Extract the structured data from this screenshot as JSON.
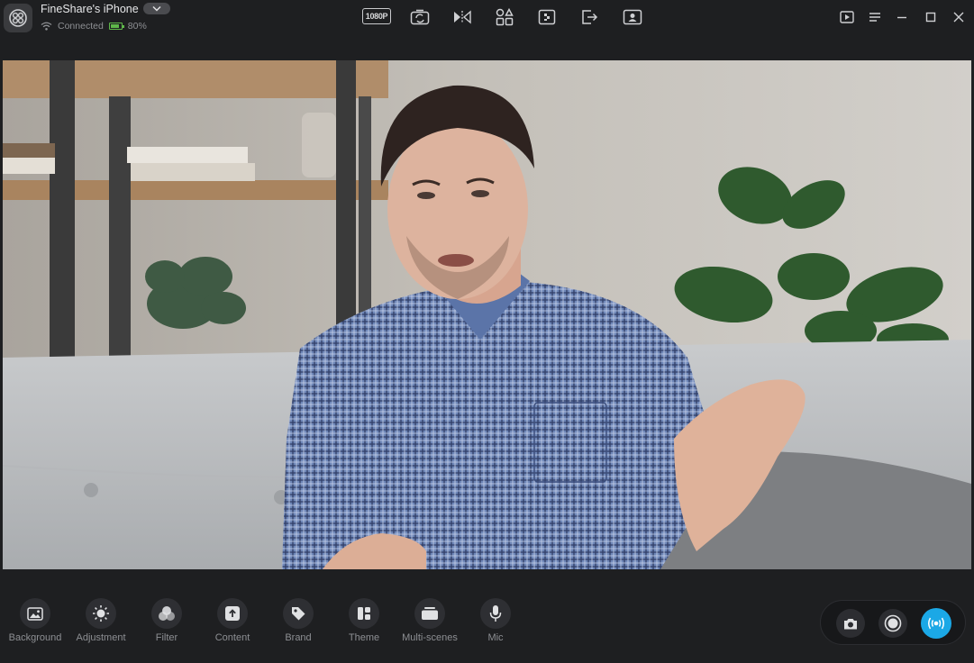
{
  "window": {
    "device_name": "FineShare's iPhone",
    "connection_status": "Connected",
    "battery_percent": "80%",
    "battery_level": 0.8
  },
  "toolbar": {
    "resolution_label": "1080P",
    "icons": [
      "rotate-camera-icon",
      "mirror-flip-icon",
      "effects-icon",
      "mosaic-icon",
      "exit-icon",
      "portrait-icon"
    ]
  },
  "window_controls": [
    "media-library-icon",
    "menu-icon",
    "minimize-icon",
    "maximize-icon",
    "close-icon"
  ],
  "bottom_tools": [
    {
      "label": "Background",
      "icon": "image-icon"
    },
    {
      "label": "Adjustment",
      "icon": "brightness-icon"
    },
    {
      "label": "Filter",
      "icon": "filter-icon"
    },
    {
      "label": "Content",
      "icon": "upload-icon"
    },
    {
      "label": "Brand",
      "icon": "tag-icon"
    },
    {
      "label": "Theme",
      "icon": "layout-icon"
    },
    {
      "label": "Multi-scenes",
      "icon": "scenes-icon"
    },
    {
      "label": "Mic",
      "icon": "microphone-icon"
    }
  ],
  "capture": [
    "snapshot-camera-icon",
    "record-icon",
    "live-broadcast-icon"
  ],
  "colors": {
    "background": "#1e1f21",
    "accent": "#1ba8e6",
    "battery": "#5fb84a"
  }
}
